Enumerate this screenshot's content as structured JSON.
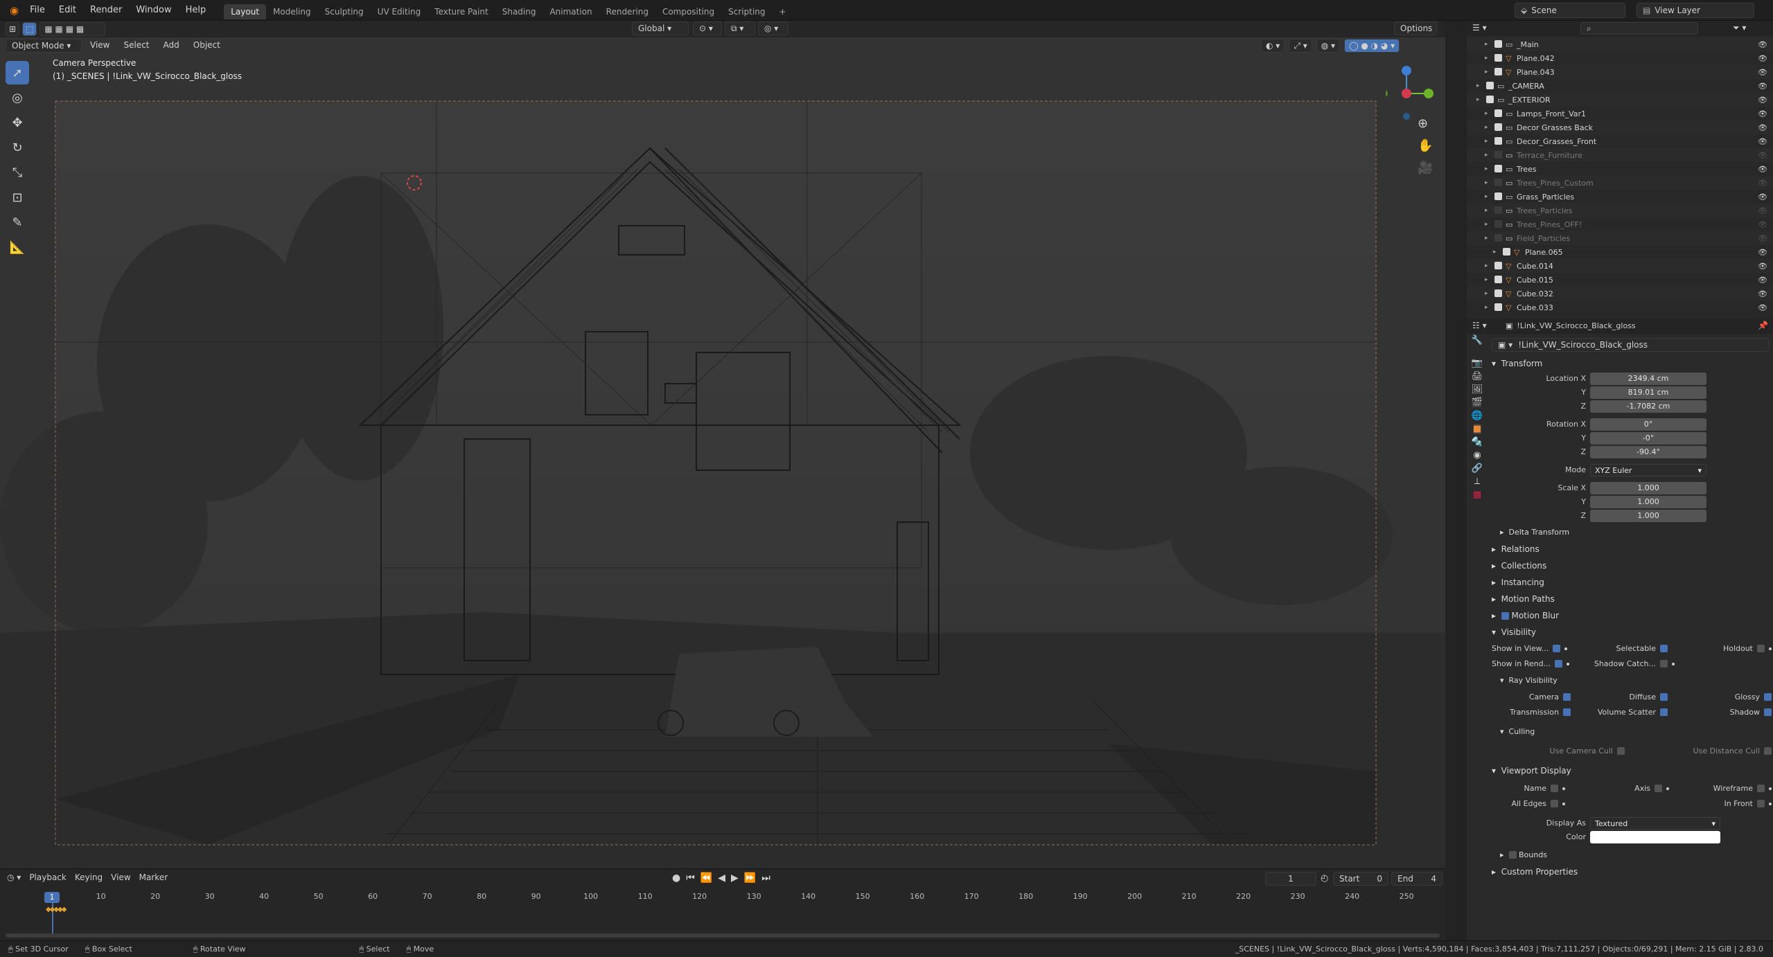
{
  "menus": [
    "File",
    "Edit",
    "Render",
    "Window",
    "Help"
  ],
  "workspaces": [
    "Layout",
    "Modeling",
    "Sculpting",
    "UV Editing",
    "Texture Paint",
    "Shading",
    "Animation",
    "Rendering",
    "Compositing",
    "Scripting"
  ],
  "active_workspace": "Layout",
  "scene_name": "Scene",
  "view_layer": "View Layer",
  "header": {
    "transform_orientation": "Global",
    "options": "Options"
  },
  "viewport_header": {
    "mode": "Object Mode",
    "menus": [
      "View",
      "Select",
      "Add",
      "Object"
    ]
  },
  "viewport": {
    "title": "Camera Perspective",
    "subtitle": "(1) _SCENES | !Link_VW_Scirocco_Black_gloss"
  },
  "outliner": {
    "rows": [
      {
        "name": "_Main",
        "indent": 2,
        "disabled": false
      },
      {
        "name": "Plane.042",
        "indent": 2,
        "disabled": false
      },
      {
        "name": "Plane.043",
        "indent": 2,
        "disabled": false
      },
      {
        "name": "_CAMERA",
        "indent": 1,
        "disabled": false
      },
      {
        "name": "_EXTERIOR",
        "indent": 1,
        "disabled": false
      },
      {
        "name": "Lamps_Front_Var1",
        "indent": 2,
        "disabled": false
      },
      {
        "name": "Decor Grasses Back",
        "indent": 2,
        "disabled": false
      },
      {
        "name": "Decor_Grasses_Front",
        "indent": 2,
        "disabled": false
      },
      {
        "name": "Terrace_Furniture",
        "indent": 2,
        "disabled": true
      },
      {
        "name": "Trees",
        "indent": 2,
        "disabled": false
      },
      {
        "name": "Trees_Pines_Custom",
        "indent": 2,
        "disabled": true
      },
      {
        "name": "Grass_Particles",
        "indent": 2,
        "disabled": false
      },
      {
        "name": "Trees_Particles",
        "indent": 2,
        "disabled": true
      },
      {
        "name": "Trees_Pines_OFF!",
        "indent": 2,
        "disabled": true
      },
      {
        "name": "Field_Particles",
        "indent": 2,
        "disabled": true
      },
      {
        "name": "Plane.065",
        "indent": 3,
        "disabled": false
      },
      {
        "name": "Cube.014",
        "indent": 2,
        "disabled": false
      },
      {
        "name": "Cube.015",
        "indent": 2,
        "disabled": false
      },
      {
        "name": "Cube.032",
        "indent": 2,
        "disabled": false
      },
      {
        "name": "Cube.033",
        "indent": 2,
        "disabled": false
      }
    ]
  },
  "properties": {
    "object_name": "!Link_VW_Scirocco_Black_gloss",
    "data_name": "!Link_VW_Scirocco_Black_gloss",
    "transform": {
      "title": "Transform",
      "location_label": "Location X",
      "loc_x": "2349.4 cm",
      "loc_y": "819.01 cm",
      "loc_z": "-1.7082 cm",
      "rotation_label": "Rotation X",
      "rot_x": "0°",
      "rot_y": "-0°",
      "rot_z": "-90.4°",
      "mode_label": "Mode",
      "mode": "XYZ Euler",
      "scale_label": "Scale X",
      "scale_x": "1.000",
      "scale_y": "1.000",
      "scale_z": "1.000",
      "y": "Y",
      "z": "Z",
      "delta": "Delta Transform"
    },
    "panels": [
      "Relations",
      "Collections",
      "Instancing",
      "Motion Paths",
      "Motion Blur"
    ],
    "visibility": {
      "title": "Visibility",
      "show_in_viewport": "Show in View...",
      "show_in_render": "Show in Rend...",
      "selectable": "Selectable",
      "shadow_catcher": "Shadow Catch...",
      "holdout": "Holdout",
      "ray_title": "Ray Visibility",
      "camera": "Camera",
      "diffuse": "Diffuse",
      "glossy": "Glossy",
      "transmission": "Transmission",
      "volume_scatter": "Volume Scatter",
      "shadow": "Shadow",
      "culling_title": "Culling",
      "use_camera_cull": "Use Camera Cull",
      "use_distance_cull": "Use Distance Cull"
    },
    "viewport_display": {
      "title": "Viewport Display",
      "name": "Name",
      "axis": "Axis",
      "wireframe": "Wireframe",
      "all_edges": "All Edges",
      "in_front": "In Front",
      "display_as_label": "Display As",
      "display_as": "Textured",
      "color_label": "Color",
      "bounds": "Bounds"
    },
    "custom_properties": "Custom Properties"
  },
  "timeline": {
    "menus": [
      "Playback",
      "Keying",
      "View",
      "Marker"
    ],
    "current_frame": "1",
    "start_label": "Start",
    "start": "0",
    "end_label": "End",
    "end": "4",
    "ticks": [
      "1",
      "10",
      "20",
      "30",
      "40",
      "50",
      "60",
      "70",
      "80",
      "90",
      "100",
      "110",
      "120",
      "130",
      "140",
      "150",
      "160",
      "170",
      "180",
      "190",
      "200",
      "210",
      "220",
      "230",
      "240",
      "250"
    ]
  },
  "statusbar": {
    "left": [
      "Set 3D Cursor",
      "Box Select",
      "Rotate View",
      "Select",
      "Move"
    ],
    "right": "_SCENES | !Link_VW_Scirocco_Black_gloss | Verts:4,590,184 | Faces:3,854,403 | Tris:7,111,257 | Objects:0/69,291 | Mem: 2.15 GiB | 2.83.0"
  },
  "colors": {
    "accent": "#4772b3",
    "bg": "#1d1d1d",
    "panel": "#2a2a2a",
    "field": "#545454"
  }
}
